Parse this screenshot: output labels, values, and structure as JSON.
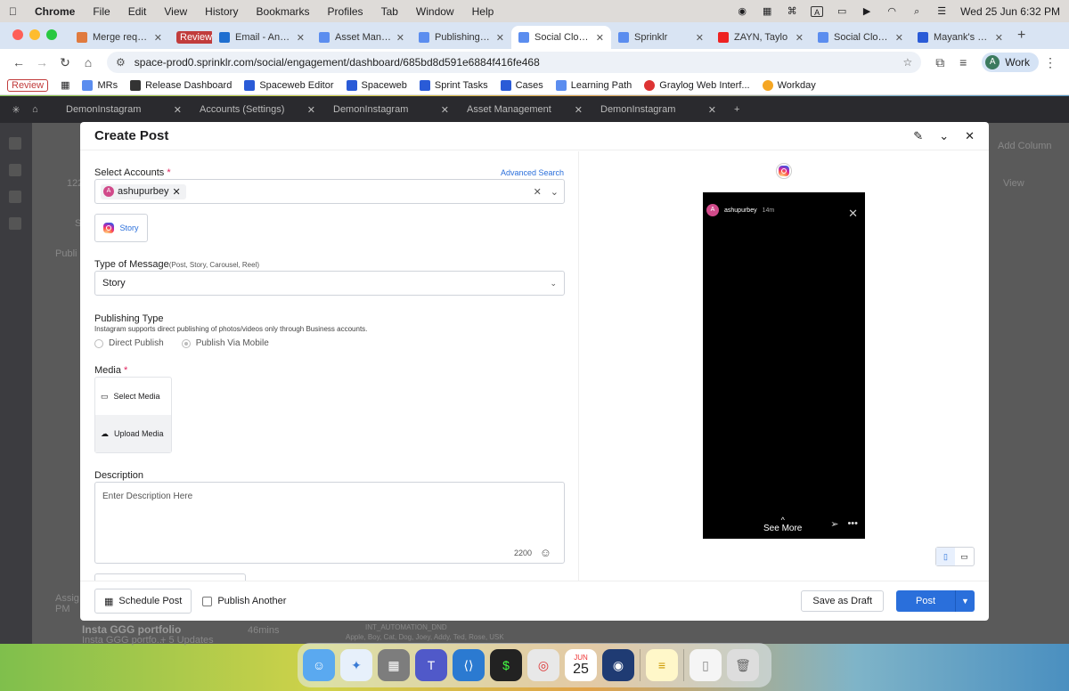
{
  "menubar": {
    "app": "Chrome",
    "items": [
      "File",
      "Edit",
      "View",
      "History",
      "Bookmarks",
      "Profiles",
      "Tab",
      "Window",
      "Help"
    ],
    "clock": "Wed 25 Jun  6:32 PM",
    "input_source": "A"
  },
  "tabs": [
    {
      "label": "Merge requests",
      "color": "#e07a3e"
    },
    {
      "label": "Review",
      "badge": true
    },
    {
      "label": "Email - Anand N",
      "color": "#1f6fd0"
    },
    {
      "label": "Asset Manager",
      "color": "#5b8def"
    },
    {
      "label": "Publishing Sev0",
      "color": "#5b8def"
    },
    {
      "label": "Social Cloud / E",
      "color": "#5b8def",
      "active": true
    },
    {
      "label": "Sprinklr",
      "color": "#5b8def"
    },
    {
      "label": "ZAYN, Taylo",
      "color": "#e22"
    },
    {
      "label": "Social Cloud / E",
      "color": "#5b8def"
    },
    {
      "label": "Mayank's Relea",
      "color": "#2a5bd7"
    }
  ],
  "address": {
    "url": "space-prod0.sprinklr.com/social/engagement/dashboard/685bd8d591e6884f416fe468",
    "profile": "Work",
    "profile_initial": "A"
  },
  "bookmarks": [
    "Review",
    "MRs",
    "Release Dashboard",
    "Spaceweb Editor",
    "Spaceweb",
    "Sprint Tasks",
    "Cases",
    "Learning Path",
    "Graylog Web Interf...",
    "Workday"
  ],
  "app_bg": {
    "tabs": [
      "DemonInstagram",
      "Accounts (Settings)",
      "DemonInstagram",
      "Asset Management",
      "DemonInstagram"
    ],
    "add_column": "Add Column",
    "view": "View",
    "count": "122",
    "s_text": "S",
    "publi_text": "Publi",
    "assign_text": "Assig",
    "pm_text": "PM",
    "portfolio_title": "Insta GGG portfolio",
    "portfolio_sub": "Insta GGG portfo...",
    "updates": "+ 5 Updates",
    "time_ago": "46mins",
    "automation": "INT_AUTOMATION_DND",
    "names": "Apple, Boy, Cat, Dog, Joey, Addy, Ted, Rose, USK"
  },
  "modal": {
    "title": "Create Post",
    "select_accounts_label": "Select Accounts",
    "advanced_search": "Advanced Search",
    "account_chip": "ashupurbey",
    "account_initial": "A",
    "story_option": "Story",
    "type_label": "Type of Message",
    "type_hint": "(Post, Story, Carousel, Reel)",
    "type_value": "Story",
    "publishing_type_label": "Publishing Type",
    "publishing_hint": "Instagram supports direct publishing of photos/videos only through Business accounts.",
    "radio_direct": "Direct Publish",
    "radio_mobile": "Publish Via Mobile",
    "media_label": "Media",
    "select_media": "Select Media",
    "upload_media": "Upload Media",
    "description_label": "Description",
    "description_placeholder": "Enter Description Here",
    "char_count": "2200",
    "schedule_post": "Schedule Post",
    "publish_another": "Publish Another",
    "save_draft": "Save as Draft",
    "post": "Post",
    "required_mark": "*"
  },
  "preview": {
    "username": "ashupurbey",
    "time": "14m",
    "avatar_initial": "A",
    "see_more": "See More"
  },
  "dock": {
    "calendar_month": "JUN",
    "calendar_day": "25"
  },
  "colors": {
    "accent": "#2a6fdb",
    "required": "#e0245e"
  }
}
